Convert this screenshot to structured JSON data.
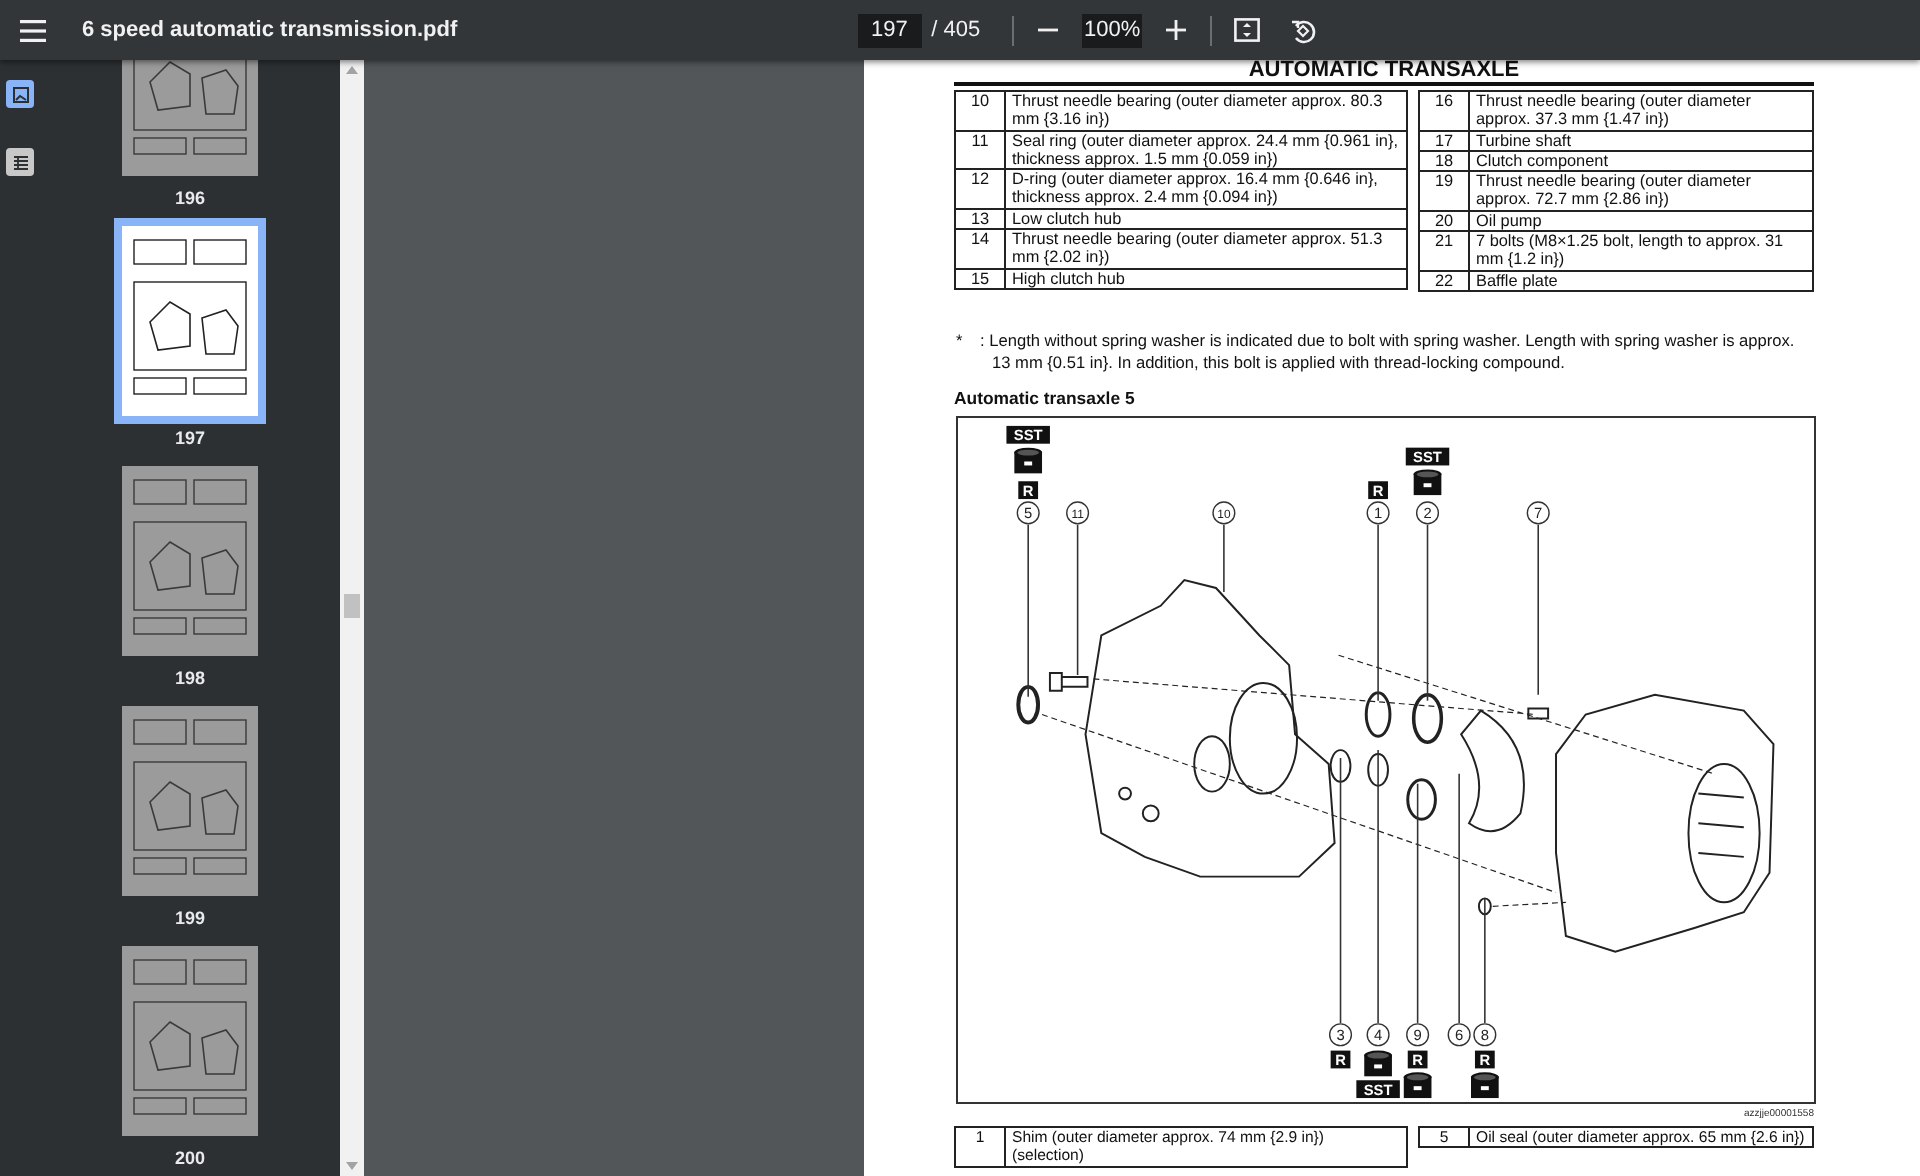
{
  "toolbar": {
    "title": "6 speed automatic transmission.pdf",
    "page_input": "197",
    "page_total": "/ 405",
    "zoom": "100%"
  },
  "sidebar": {
    "views": [
      {
        "kind": "thumbnails",
        "selected": true
      },
      {
        "kind": "outline",
        "selected": false
      }
    ],
    "pages": [
      {
        "label": "196",
        "selected": false
      },
      {
        "label": "197",
        "selected": true
      },
      {
        "label": "198",
        "selected": false
      },
      {
        "label": "199",
        "selected": false
      },
      {
        "label": "200",
        "selected": false
      }
    ]
  },
  "document": {
    "heading": "AUTOMATIC TRANSAXLE",
    "top_tables": [
      [
        {
          "number": "10",
          "text": "Thrust needle bearing (outer diameter approx. 80.3 mm {3.16 in})"
        },
        {
          "number": "11",
          "text": "Seal ring (outer diameter approx. 24.4 mm {0.961 in}, thickness approx. 1.5 mm {0.059 in})"
        },
        {
          "number": "12",
          "text": "D-ring (outer diameter approx. 16.4 mm {0.646 in}, thickness approx. 2.4 mm {0.094 in})"
        },
        {
          "number": "13",
          "text": "Low clutch hub"
        },
        {
          "number": "14",
          "text": "Thrust needle bearing (outer diameter approx. 51.3 mm {2.02 in})"
        },
        {
          "number": "15",
          "text": "High clutch hub"
        }
      ],
      [
        {
          "number": "16",
          "text": "Thrust needle bearing (outer diameter approx. 37.3 mm {1.47 in})"
        },
        {
          "number": "17",
          "text": "Turbine shaft"
        },
        {
          "number": "18",
          "text": "Clutch component"
        },
        {
          "number": "19",
          "text": "Thrust needle bearing (outer diameter approx. 72.7 mm {2.86 in})"
        },
        {
          "number": "20",
          "text": "Oil pump"
        },
        {
          "number": "21",
          "text": "7 bolts (M8×1.25 bolt, length to approx. 31 mm {1.2 in})"
        },
        {
          "number": "22",
          "text": "Baffle plate"
        }
      ]
    ],
    "footnote": {
      "mark": "*",
      "text": ": Length without spring washer is indicated due to bolt with spring washer. Length with spring washer is approx. 13 mm {0.51 in}. In addition, this bolt is applied with thread-locking compound."
    },
    "figure": {
      "title": "Automatic transaxle 5",
      "callouts": [
        {
          "number": "5",
          "tags": [
            "SST",
            "R"
          ]
        },
        {
          "number": "11"
        },
        {
          "number": "10"
        },
        {
          "number": "1",
          "tags": [
            "R"
          ]
        },
        {
          "number": "2",
          "tags": [
            "SST"
          ]
        },
        {
          "number": "7"
        },
        {
          "number": "3",
          "tags": [
            "R"
          ]
        },
        {
          "number": "4",
          "tags": [
            "SST"
          ]
        },
        {
          "number": "9",
          "tags": [
            "R"
          ]
        },
        {
          "number": "6"
        },
        {
          "number": "8",
          "tags": [
            "R"
          ]
        }
      ],
      "code": "azzjje00001558"
    },
    "bottom_tables": [
      [
        {
          "number": "1",
          "text": "Shim (outer diameter approx. 74 mm {2.9 in}) (selection)"
        }
      ],
      [
        {
          "number": "5",
          "text": "Oil seal (outer diameter approx. 65 mm {2.6 in})"
        }
      ]
    ]
  }
}
